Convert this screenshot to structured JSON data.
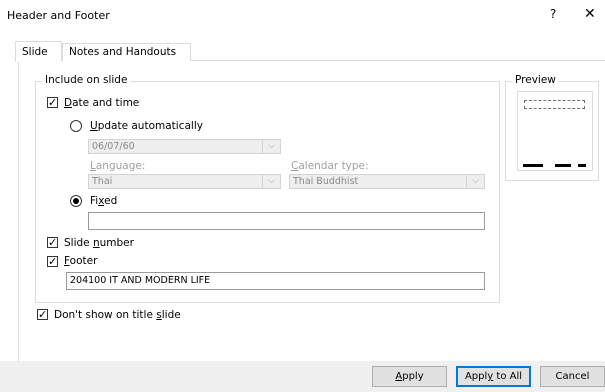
{
  "window": {
    "title": "Header and Footer",
    "help_glyph": "?",
    "close_glyph": "✕"
  },
  "tabs": [
    {
      "label": "Slide",
      "active": true
    },
    {
      "label": "Notes and Handouts",
      "active": false
    }
  ],
  "include": {
    "legend": "Include on slide",
    "date_time": {
      "label_pre": "",
      "label_u": "D",
      "label_post": "ate and time",
      "checked": true,
      "update_auto": {
        "label_u": "U",
        "label_post": "pdate automatically",
        "selected": false
      },
      "date_value": "06/07/60",
      "language_label_u": "L",
      "language_label_post": "anguage:",
      "language_value": "Thai",
      "calendar_label_u": "C",
      "calendar_label_post": "alendar type:",
      "calendar_value": "Thai Buddhist",
      "fixed": {
        "label_pre": "Fi",
        "label_u": "x",
        "label_post": "ed",
        "selected": true,
        "value": ""
      }
    },
    "slide_number": {
      "label_pre": "Slide ",
      "label_u": "n",
      "label_post": "umber",
      "checked": true
    },
    "footer": {
      "label_u": "F",
      "label_post": "ooter",
      "checked": true,
      "value": "204100  IT AND MODERN LIFE"
    }
  },
  "dont_show": {
    "label_pre": "Don't show on title ",
    "label_u": "s",
    "label_post": "lide",
    "checked": true
  },
  "preview": {
    "legend": "Preview"
  },
  "buttons": {
    "apply_u": "A",
    "apply_post": "pply",
    "apply_all_pre": "Appl",
    "apply_all_u": "y",
    "apply_all_post": " to All",
    "cancel": "Cancel"
  },
  "glyphs": {
    "check": "✓",
    "dropdown": "⌵"
  }
}
